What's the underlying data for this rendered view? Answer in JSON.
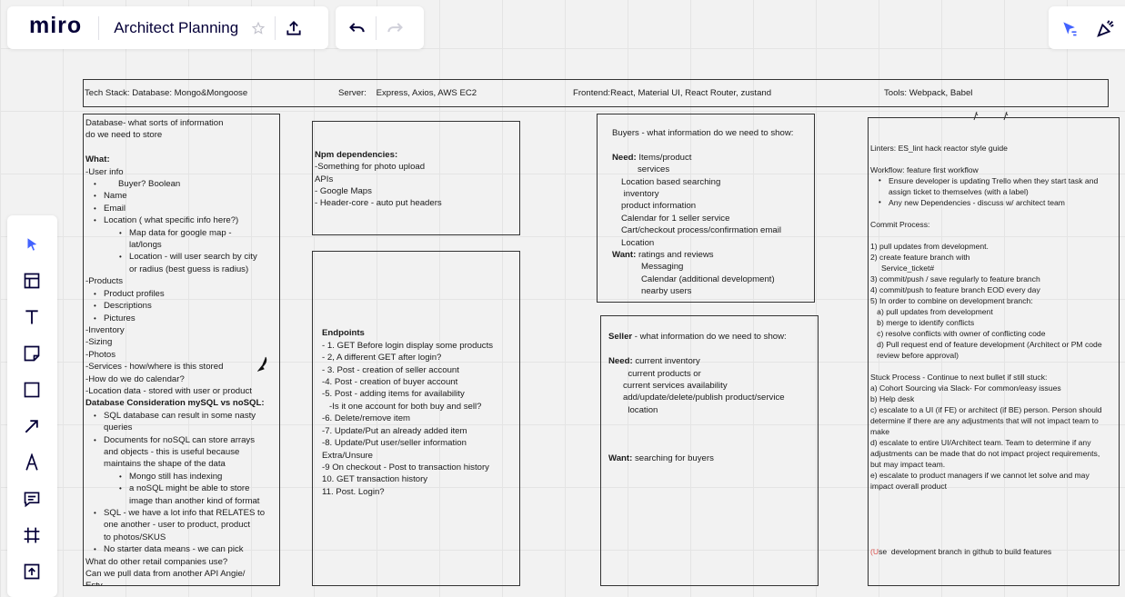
{
  "header": {
    "logo": "miro",
    "board_title": "Architect Planning"
  },
  "colors": {
    "accent": "#4262ff",
    "ink": "#050038"
  },
  "tech_stack": {
    "database": "Tech Stack: Database: Mongo&Mongoose",
    "server": "Server:    Express, Axios, AWS EC2",
    "frontend": "Frontend:React, Material UI,  React Router, zustand",
    "tools": "Tools: Webpack, Babel"
  },
  "notes": [
    {
      "id": "database",
      "lines": [
        {
          "t": "Database- what sorts of information"
        },
        {
          "t": "do we need to store"
        },
        {
          "t": " "
        },
        {
          "b": "What:"
        },
        {
          "t": "-User info"
        },
        {
          "t": "      Buyer? Boolean",
          "k": "b1"
        },
        {
          "t": "Name",
          "k": "b1"
        },
        {
          "t": "Email",
          "k": "b1"
        },
        {
          "t": "Location ( what specific info here?)",
          "k": "b1"
        },
        {
          "t": "Map data for google map -",
          "k": "b2"
        },
        {
          "t": "lat/longs",
          "k": "c2"
        },
        {
          "t": "Location - will user search by city",
          "k": "b2"
        },
        {
          "t": "or radius (best guess is radius)",
          "k": "c2"
        },
        {
          "t": "-Products"
        },
        {
          "t": "Product profiles",
          "k": "b1"
        },
        {
          "t": "Descriptions",
          "k": "b1"
        },
        {
          "t": "Pictures",
          "k": "b1"
        },
        {
          "t": "-Inventory"
        },
        {
          "t": "-Sizing"
        },
        {
          "t": "-Photos"
        },
        {
          "t": "-Services - how/where is this stored"
        },
        {
          "t": "-How do we do calendar?"
        },
        {
          "t": "-Location data - stored with user or product"
        },
        {
          "b": "Database Consideration mySQL vs noSQL:"
        },
        {
          "t": "SQL database can result in some nasty",
          "k": "b1"
        },
        {
          "t": "queries",
          "k": "c1"
        },
        {
          "t": "Documents for noSQL can store arrays",
          "k": "b1"
        },
        {
          "t": "and objects - this is useful because",
          "k": "c1"
        },
        {
          "t": "maintains the shape of the data",
          "k": "c1"
        },
        {
          "t": "Mongo still has indexing",
          "k": "b2"
        },
        {
          "t": "a noSQL might be able to store",
          "k": "b2"
        },
        {
          "t": "image than another kind of format",
          "k": "c2"
        },
        {
          "t": "SQL - we have a lot info that RELATES to",
          "k": "b1"
        },
        {
          "t": "one another - user to product, product",
          "k": "c1"
        },
        {
          "t": "to photos/SKUS",
          "k": "c1"
        },
        {
          "t": "No starter data means - we can pick",
          "k": "b1"
        },
        {
          "t": "What do other retail companies use?"
        },
        {
          "t": "Can we pull data from another API Angie/"
        },
        {
          "t": "Esty"
        }
      ]
    },
    {
      "id": "npm",
      "lines": [
        {
          "t": " "
        },
        {
          "t": " "
        },
        {
          "b": "Npm dependencies:"
        },
        {
          "t": "-Something for photo upload"
        },
        {
          "t": "APIs"
        },
        {
          "t": "- Google Maps"
        },
        {
          "t": "- Header-core - auto put headers"
        }
      ]
    },
    {
      "id": "endpoints",
      "lines": [
        {
          "t": " "
        },
        {
          "t": " "
        },
        {
          "t": " "
        },
        {
          "t": " "
        },
        {
          "t": " "
        },
        {
          "t": " "
        },
        {
          "b": "Endpoints"
        },
        {
          "t": "- 1. GET Before login display some products"
        },
        {
          "t": "- 2, A different GET after login?"
        },
        {
          "t": "- 3. Post - creation of seller account"
        },
        {
          "t": "-4. Post - creation of buyer account"
        },
        {
          "t": "-5. Post - adding items for availability"
        },
        {
          "t": "   -Is it one account for both buy and sell?"
        },
        {
          "t": "-6. Delete/remove item"
        },
        {
          "t": "-7. Update/Put an already added item"
        },
        {
          "t": "-8. Update/Put user/seller information"
        },
        {
          "t": "Extra/Unsure"
        },
        {
          "t": "-9 On checkout - Post to transaction history"
        },
        {
          "t": "10. GET transaction history"
        },
        {
          "t": "11. Post. Login?"
        }
      ]
    },
    {
      "id": "buyers",
      "lines": [
        {
          "t": "Buyers - what information do we need to show:"
        },
        {
          "t": " "
        },
        {
          "b": "Need: ",
          "t": "Items/product"
        },
        {
          "t": "services",
          "k": "i2"
        },
        {
          "t": "Location based searching",
          "k": "i1"
        },
        {
          "t": " inventory",
          "k": "i1"
        },
        {
          "t": "product information",
          "k": "i1"
        },
        {
          "t": "Calendar for 1 seller service",
          "k": "i1"
        },
        {
          "t": "Cart/checkout process/confirmation email",
          "k": "i1"
        },
        {
          "t": "Location",
          "k": "i1"
        },
        {
          "b": "Want: ",
          "t": "ratings and reviews"
        },
        {
          "t": "Messaging",
          "k": "i3"
        },
        {
          "t": "Calendar (additional development)",
          "k": "i3"
        },
        {
          "t": "nearby users",
          "k": "i3"
        }
      ]
    },
    {
      "id": "seller",
      "lines": [
        {
          "t": " "
        },
        {
          "b": "Seller",
          "t": " - what information do we need to show:"
        },
        {
          "t": " "
        },
        {
          "b": "Need: ",
          "t": "current inventory"
        },
        {
          "t": "        current products or"
        },
        {
          "t": "      current services availability"
        },
        {
          "t": "      add/update/delete/publish product/service"
        },
        {
          "t": "        location"
        },
        {
          "t": " "
        },
        {
          "t": " "
        },
        {
          "t": " "
        },
        {
          "b": "Want: ",
          "t": "searching for buyers"
        }
      ]
    },
    {
      "id": "process",
      "lines": [
        {
          "t": " "
        },
        {
          "t": " "
        },
        {
          "t": "Linters: ES_lint hack reactor style guide"
        },
        {
          "t": " "
        },
        {
          "t": "Workflow: feature first workflow"
        },
        {
          "t": "Ensure developer is updating Trello when they start task and",
          "k": "b1"
        },
        {
          "t": "assign ticket to themselves (with a label)",
          "k": "c1"
        },
        {
          "t": "Any new Dependencies - discuss w/ architect team",
          "k": "b1"
        },
        {
          "t": " "
        },
        {
          "t": "Commit Process:"
        },
        {
          "t": " "
        },
        {
          "t": "1) pull updates from development."
        },
        {
          "t": "2) create feature branch with"
        },
        {
          "t": "     Service_ticket#"
        },
        {
          "t": "3) commit/push / save regularly to feature branch"
        },
        {
          "t": "4) commit/push to feature branch EOD every day"
        },
        {
          "t": "5) In order to combine on development branch:"
        },
        {
          "t": "   a) pull updates from development"
        },
        {
          "t": "   b) merge to identify conflicts"
        },
        {
          "t": "   c) resolve conflicts with owner of conflicting code"
        },
        {
          "t": "   d) Pull request end of feature development (Architect or PM code"
        },
        {
          "t": "   review before approval)"
        },
        {
          "t": " "
        },
        {
          "t": "Stuck Process - Continue to next bullet if still stuck:"
        },
        {
          "t": "a) Cohort Sourcing via Slack- For common/easy issues"
        },
        {
          "t": "b) Help desk"
        },
        {
          "t": "c) escalate to a UI (if FE) or architect (if BE) person. Person should"
        },
        {
          "t": "determine if there are any adjustments that will not impact team to"
        },
        {
          "t": "make"
        },
        {
          "t": "d) escalate to entire UI/Architect team. Team to determine if any"
        },
        {
          "t": "adjustments can be made that do not impact project requirements,"
        },
        {
          "t": "but may impact team."
        },
        {
          "t": "e) escalate to product managers if we cannot let solve and may"
        },
        {
          "t": "impact overall product"
        },
        {
          "t": " "
        },
        {
          "t": " "
        },
        {
          "t": " "
        },
        {
          "t": " "
        },
        {
          "t": " "
        },
        {
          "r": "(U",
          "t": "se  development branch in github to build features"
        }
      ]
    }
  ]
}
